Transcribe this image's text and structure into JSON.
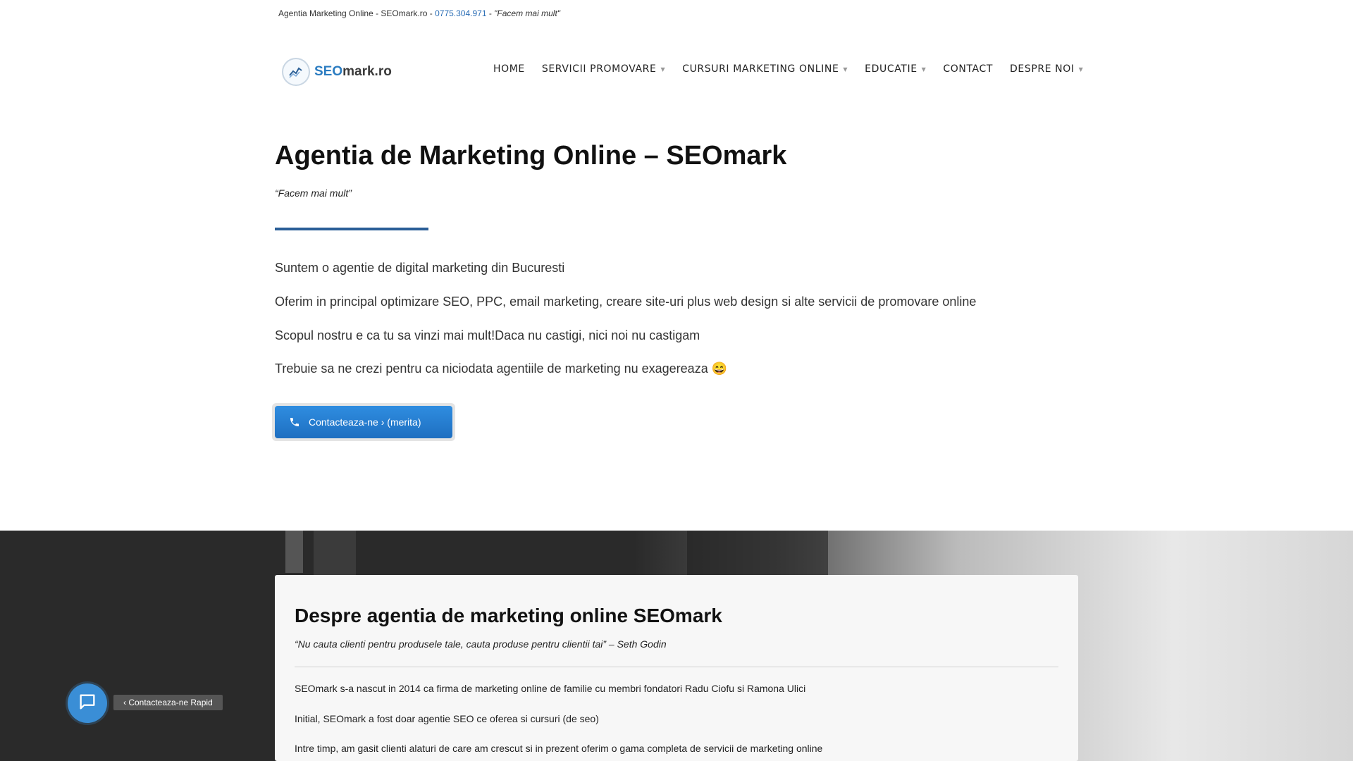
{
  "topbar": {
    "site": "Agentia Marketing Online - SEOmark.ro - ",
    "phone": "0775.304.971",
    "separator": " - ",
    "slogan": "\"Facem mai mult\""
  },
  "logo": {
    "part1": "SEO",
    "part2": "mark.ro"
  },
  "nav": {
    "items": [
      {
        "label": "HOME"
      },
      {
        "label": "SERVICII PROMOVARE",
        "caret": "▼"
      },
      {
        "label": "CURSURI MARKETING ONLINE",
        "caret": "▼"
      },
      {
        "label": "EDUCATIE",
        "caret": "▼"
      },
      {
        "label": "CONTACT"
      },
      {
        "label": "DESPRE NOI",
        "caret": "▼"
      }
    ]
  },
  "hero": {
    "title": "Agentia de Marketing Online – SEOmark",
    "subtitle": "“Facem mai mult”",
    "paragraphs": [
      "Suntem o agentie de digital marketing din Bucuresti",
      "Oferim in principal optimizare SEO, PPC, email marketing, creare site-uri plus web design si alte servicii de promovare online",
      "Scopul nostru e ca tu sa vinzi mai mult!Daca nu castigi, nici noi nu castigam",
      "Trebuie sa ne crezi pentru ca niciodata agentiile de marketing nu exagereaza 😄"
    ],
    "cta_label": "Contacteaza-ne › (merita)",
    "accent_color": "#2a5e97"
  },
  "about": {
    "title": "Despre agentia de marketing online SEOmark",
    "quote": "“Nu cauta clienti pentru produsele tale, cauta produse pentru clientii tai” – Seth Godin",
    "paragraphs": [
      "SEOmark s-a nascut in 2014 ca firma de marketing online de familie cu membri fondatori Radu Ciofu si Ramona Ulici",
      "Initial, SEOmark a fost doar agentie SEO ce oferea si cursuri (de seo)",
      "Intre timp, am gasit clienti alaturi de care am crescut si in prezent oferim o gama completa de servicii de marketing online"
    ]
  },
  "chat": {
    "label": "‹ Contacteaza-ne Rapid",
    "icon": "chat-bubble-icon",
    "color": "#3a8ed6"
  }
}
